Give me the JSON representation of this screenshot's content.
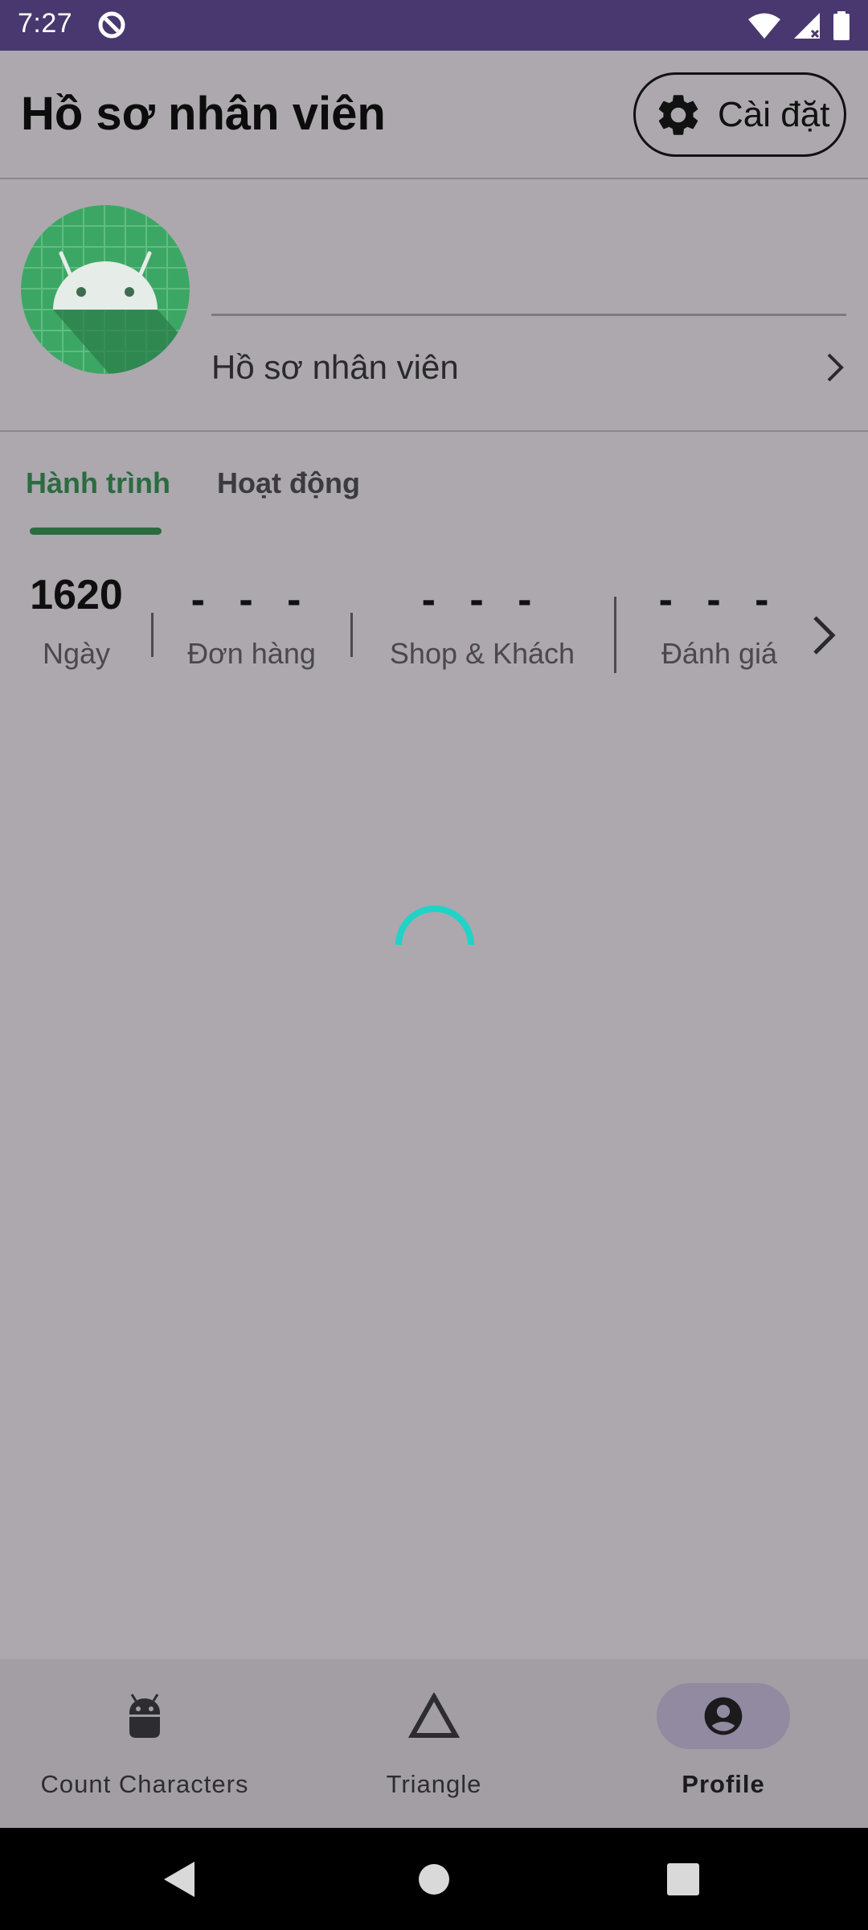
{
  "status_bar": {
    "time": "7:27",
    "icons": [
      "data-saver-icon",
      "wifi-icon",
      "signal-icon",
      "battery-icon"
    ]
  },
  "header": {
    "title": "Hồ sơ nhân viên",
    "settings_label": "Cài đặt",
    "settings_icon": "gear-icon"
  },
  "profile": {
    "avatar_icon": "android-icon",
    "link_label": "Hồ sơ nhân viên"
  },
  "tabs": [
    {
      "label": "Hành trình",
      "active": true
    },
    {
      "label": "Hoạt động",
      "active": false
    }
  ],
  "stats": [
    {
      "value": "1620",
      "label": "Ngày"
    },
    {
      "value": "- - -",
      "label": "Đơn hàng"
    },
    {
      "value": "- - -",
      "label": "Shop & Khách"
    },
    {
      "value": "- - -",
      "label": "Đánh giá"
    }
  ],
  "loading_color": "#1fd3c6",
  "accent_color": "#2b6b40",
  "bottom_nav": [
    {
      "label": "Count Characters",
      "icon": "android-icon",
      "active": false
    },
    {
      "label": "Triangle",
      "icon": "triangle-icon",
      "active": false
    },
    {
      "label": "Profile",
      "icon": "account-circle-icon",
      "active": true
    }
  ],
  "system_nav": [
    "back-icon",
    "home-icon",
    "recents-icon"
  ]
}
